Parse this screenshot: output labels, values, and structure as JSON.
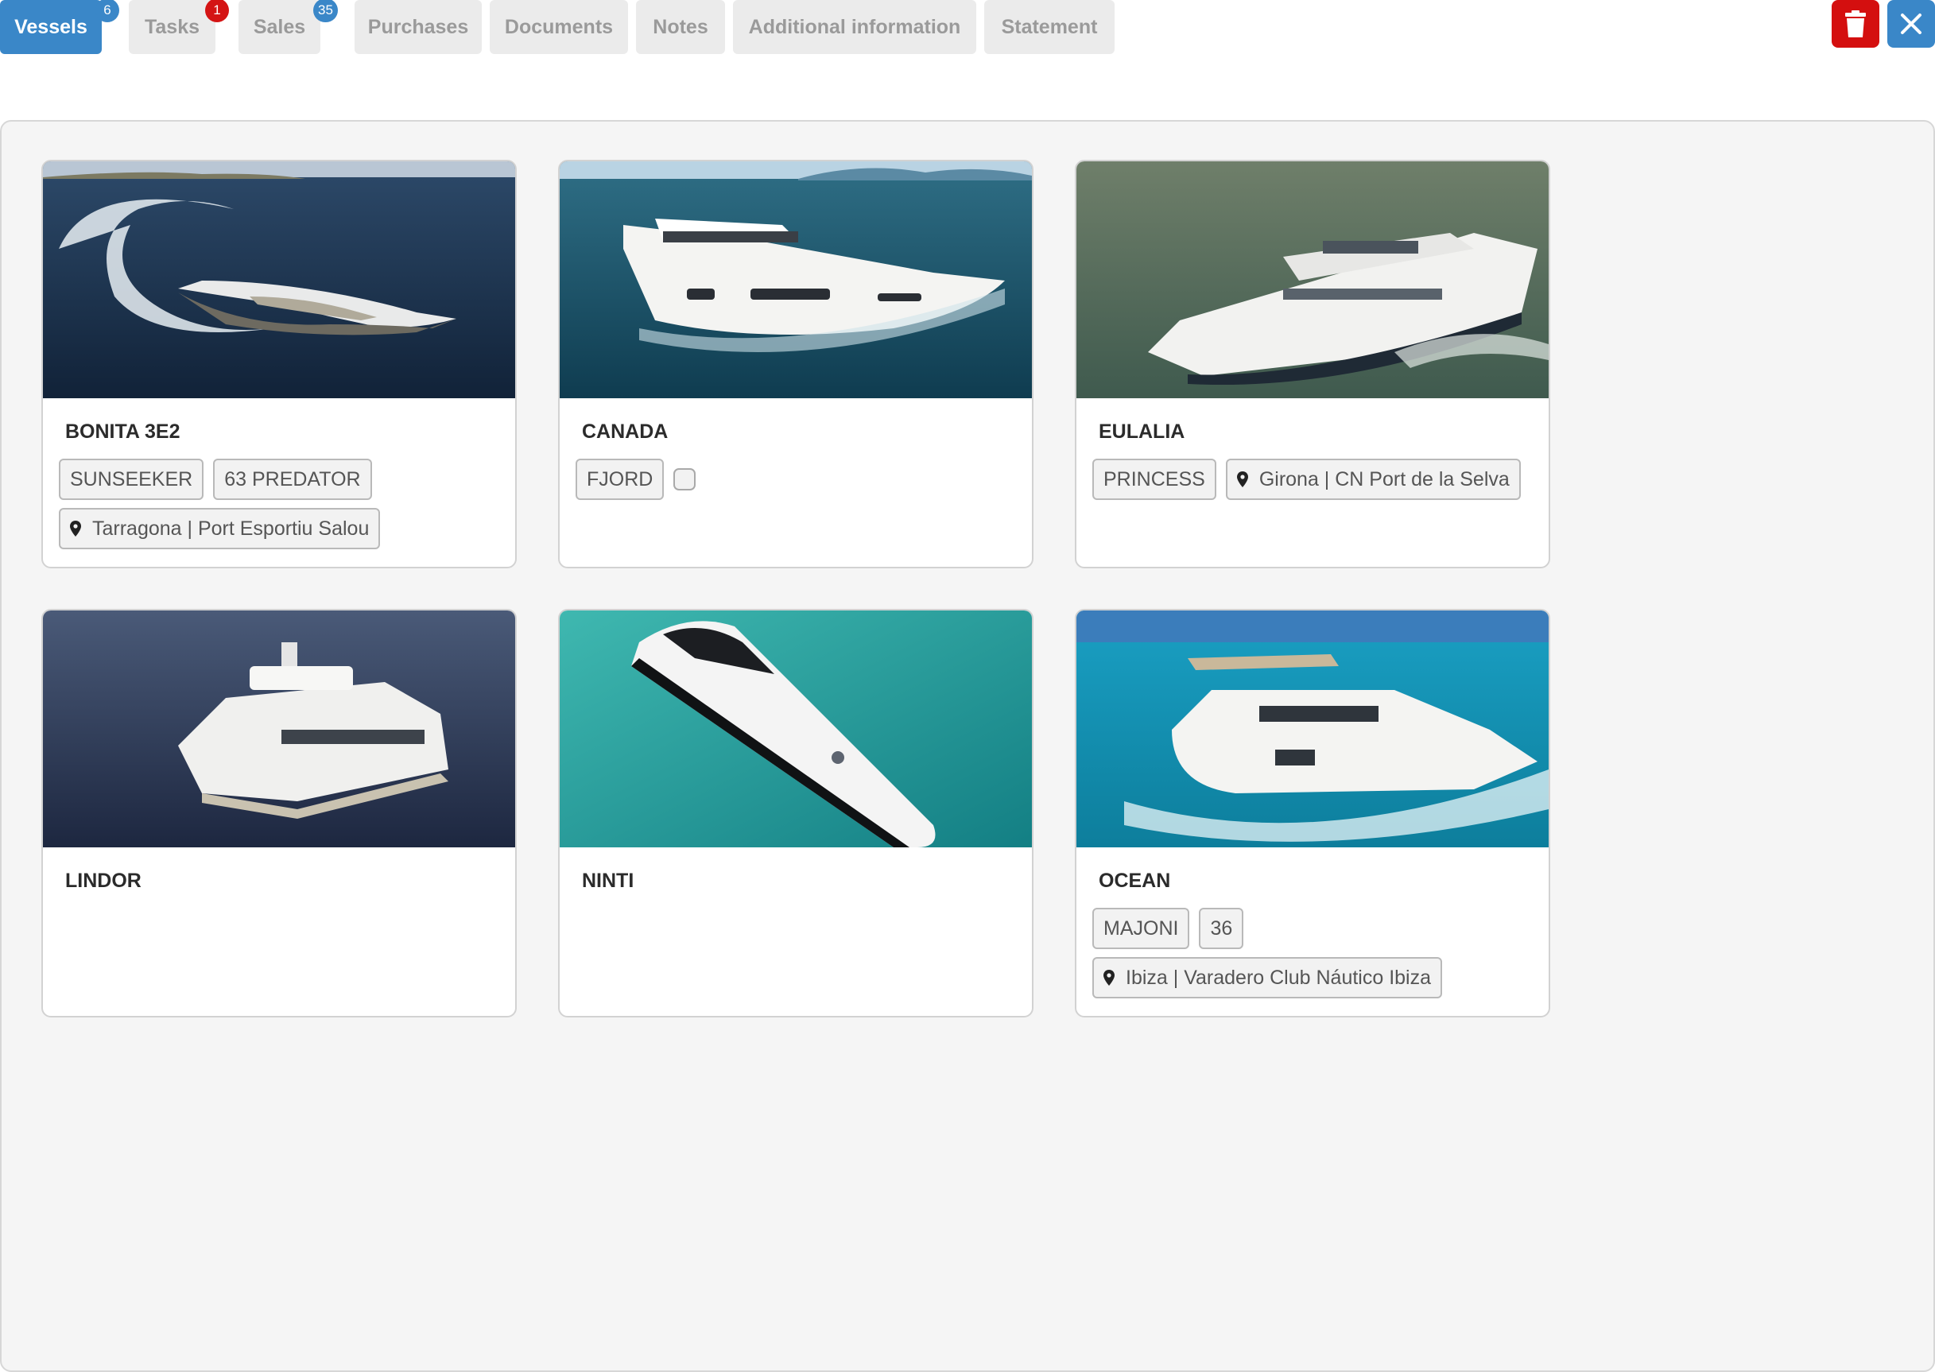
{
  "tabs": [
    {
      "label": "Vessels",
      "badge": "6",
      "active": true
    },
    {
      "label": "Tasks",
      "badge": "1",
      "badge_color": "#d41414"
    },
    {
      "label": "Sales",
      "badge": "35"
    },
    {
      "label": "Purchases"
    },
    {
      "label": "Documents"
    },
    {
      "label": "Notes"
    },
    {
      "label": "Additional information"
    },
    {
      "label": "Statement"
    }
  ],
  "actions": {
    "delete_icon": "trash-icon",
    "close_icon": "close-icon"
  },
  "colors": {
    "accent": "#3a87c8",
    "danger": "#d40f0f"
  },
  "vessels": [
    {
      "name": "BONITA 3E2",
      "tags": [
        "SUNSEEKER",
        "63 PREDATOR"
      ],
      "location": "Tarragona | Port Esportiu Salou"
    },
    {
      "name": "CANADA",
      "tags": [
        "FJORD"
      ],
      "location": ""
    },
    {
      "name": "EULALIA",
      "tags": [
        "PRINCESS"
      ],
      "location": "Girona | CN Port de la Selva"
    },
    {
      "name": "LINDOR",
      "tags": [],
      "location": ""
    },
    {
      "name": "NINTI",
      "tags": [],
      "location": ""
    },
    {
      "name": "OCEAN",
      "tags": [
        "MAJONI",
        "36"
      ],
      "location": "Ibiza | Varadero Club Náutico Ibiza"
    }
  ]
}
